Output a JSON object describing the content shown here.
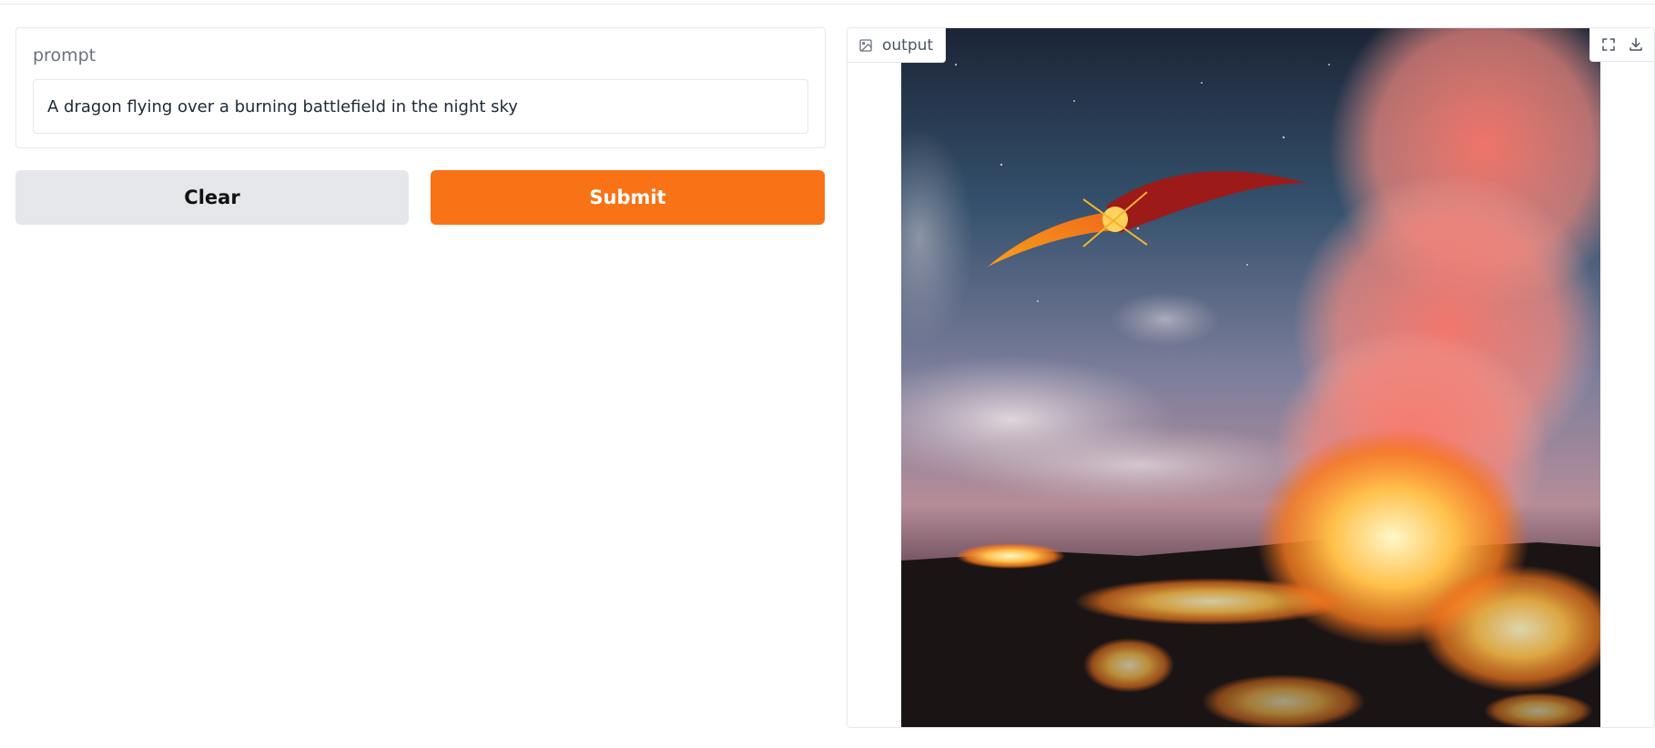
{
  "prompt": {
    "label": "prompt",
    "value": "A dragon flying over a burning battlefield in the night sky"
  },
  "buttons": {
    "clear_label": "Clear",
    "submit_label": "Submit"
  },
  "output": {
    "label": "output",
    "label_icon": "image-icon",
    "tools": [
      "fullscreen-icon",
      "download-icon"
    ]
  },
  "colors": {
    "accent": "#f97316",
    "secondary_button": "#e5e7eb",
    "border": "#e5e7eb",
    "label_text": "#6b7280"
  }
}
